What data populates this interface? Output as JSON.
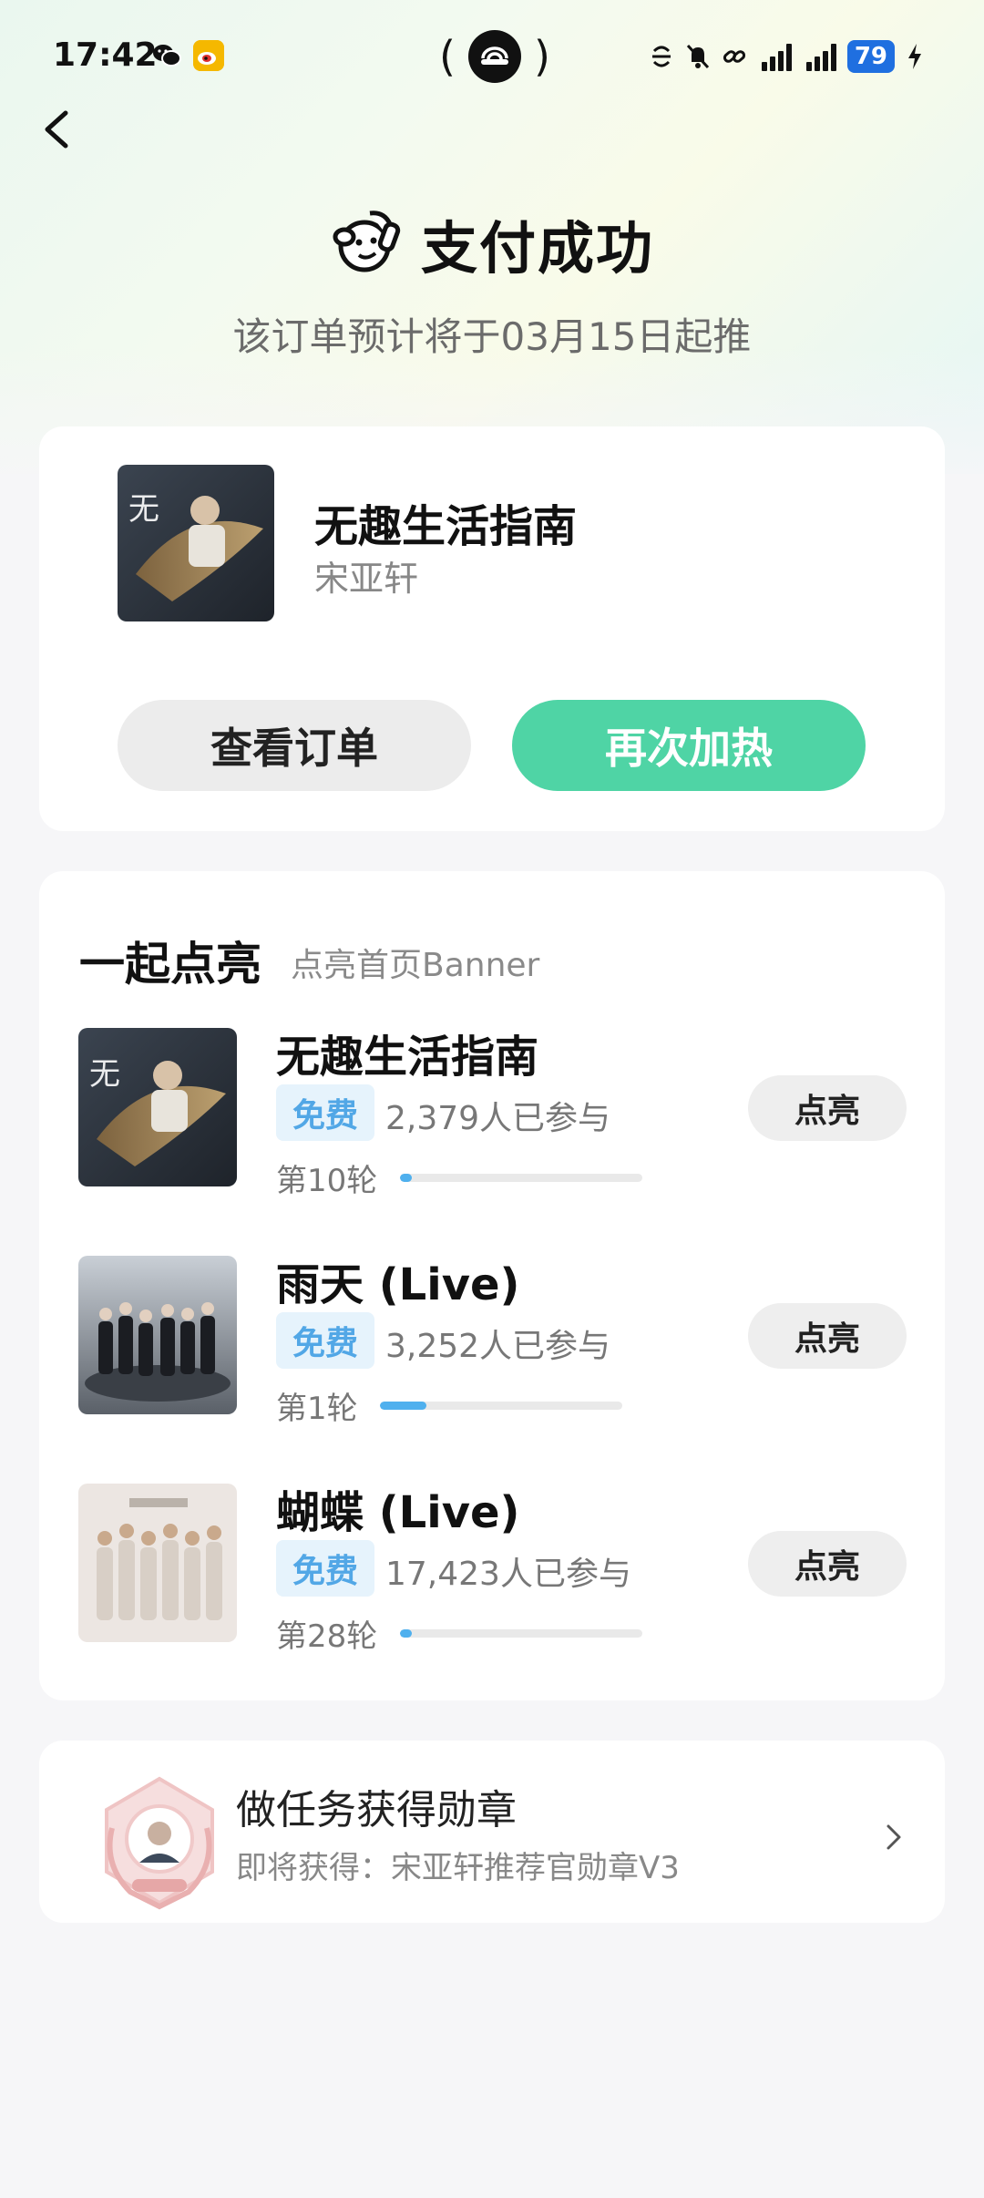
{
  "status_bar": {
    "time": "17:42",
    "battery": "79",
    "icons": [
      "wechat-icon",
      "weibo-icon",
      "hotspot-icon",
      "mute-icon",
      "signal-5g-icon",
      "charging-icon"
    ]
  },
  "header": {
    "title": "支付成功",
    "subtitle": "该订单预计将于03月15日起推"
  },
  "order_card": {
    "song_title": "无趣生活指南",
    "artist": "宋亚轩",
    "view_order_label": "查看订单",
    "reheat_label": "再次加热"
  },
  "light_up": {
    "title": "一起点亮",
    "subtitle": "点亮首页Banner",
    "items": [
      {
        "name": "无趣生活指南",
        "badge": "免费",
        "participants": "2,379人已参与",
        "round": "第10轮",
        "progress": 0.05,
        "button": "点亮"
      },
      {
        "name": "雨天 (Live)",
        "badge": "免费",
        "participants": "3,252人已参与",
        "round": "第1轮",
        "progress": 0.19,
        "button": "点亮"
      },
      {
        "name": "蝴蝶 (Live)",
        "badge": "免费",
        "participants": "17,423人已参与",
        "round": "第28轮",
        "progress": 0.05,
        "button": "点亮"
      }
    ]
  },
  "task": {
    "title": "做任务获得勋章",
    "subtitle": "即将获得：宋亚轩推荐官勋章V3"
  },
  "colors": {
    "accent_green": "#4fd4a5",
    "badge_blue": "#52a7e6",
    "progress_blue": "#4fb0ee"
  }
}
